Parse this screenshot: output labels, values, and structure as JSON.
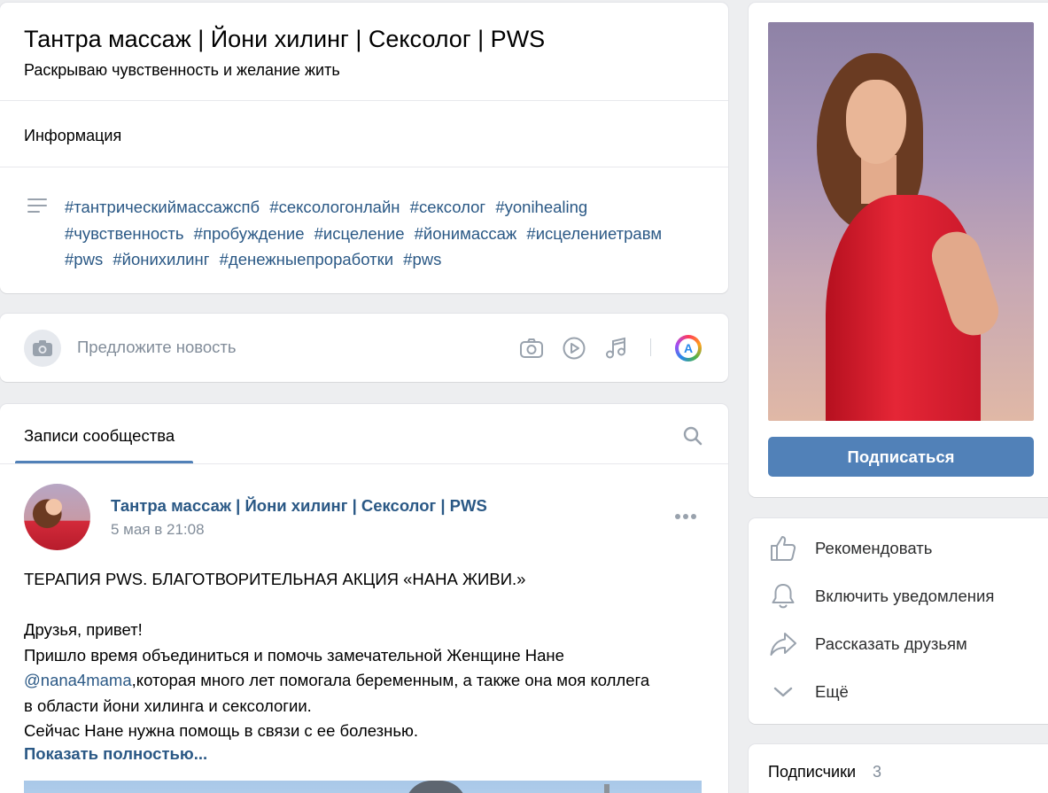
{
  "group": {
    "title": "Тантра массаж | Йони хилинг | Сексолог | PWS",
    "status": "Раскрываю чувственность и желание жить"
  },
  "info": {
    "label": "Информация",
    "tags": [
      "#тантрическиймассажспб",
      "#сексологонлайн",
      "#сексолог",
      "#yonihealing",
      "#чувственность",
      "#пробуждение",
      "#исцеление",
      "#йонимассаж",
      "#исцелениетравм",
      "#pws",
      "#йонихилинг",
      "#денежныепроработки",
      "#pws"
    ]
  },
  "suggest": {
    "placeholder": "Предложите новость",
    "ai_label": "A"
  },
  "feed": {
    "tab": "Записи сообщества"
  },
  "post": {
    "author": "Тантра массаж | Йони хилинг | Сексолог | PWS",
    "date": "5 мая в 21:08",
    "headline": "ТЕРАПИЯ PWS. БЛАГОТВОРИТЕЛЬНАЯ АКЦИЯ «НАНА ЖИВИ.»",
    "greeting": "Друзья, привет!",
    "line1": "Пришло время объединиться и помочь замечательной Женщине Нане",
    "mention": "@nana4mama",
    "line2_rest": ",которая много лет помогала беременным, а также она моя коллега",
    "line3": "в области йони хилинга и сексологии.",
    "line4": "Сейчас Нане нужна помощь в связи с ее болезнью.",
    "show_more": "Показать полностью..."
  },
  "sidebar": {
    "subscribe": "Подписаться",
    "actions": [
      "Рекомендовать",
      "Включить уведомления",
      "Рассказать друзьям",
      "Ещё"
    ],
    "followers_label": "Подписчики",
    "followers_count": "3"
  },
  "colors": {
    "link": "#2a5885",
    "accent": "#5181b8",
    "muted": "#818c99",
    "background": "#edeef0"
  }
}
